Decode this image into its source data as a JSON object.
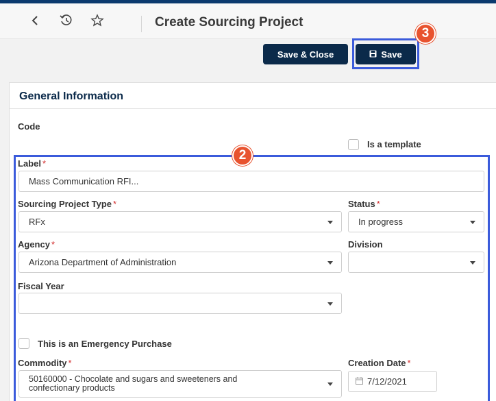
{
  "titlebar": {
    "title": "Create Sourcing Project",
    "icons": [
      "back-chevron-icon",
      "history-icon",
      "star-icon"
    ]
  },
  "toolbar": {
    "save_close_label": "Save & Close",
    "save_label": "Save"
  },
  "annotations": {
    "step_3": "3",
    "step_2": "2"
  },
  "section": {
    "title": "General Information"
  },
  "form": {
    "code_label": "Code",
    "template_label": "Is a template",
    "label_label": "Label",
    "label_value": "Mass Communication RFI...",
    "type_label": "Sourcing Project Type",
    "type_value": "RFx",
    "status_label": "Status",
    "status_value": "In progress",
    "agency_label": "Agency",
    "agency_value": "Arizona Department of Administration",
    "division_label": "Division",
    "division_value": "",
    "fiscal_label": "Fiscal Year",
    "fiscal_value": "",
    "emergency_label": "This is an Emergency Purchase",
    "commodity_label": "Commodity",
    "commodity_value": "50160000 - Chocolate and sugars and sweeteners and confectionary products",
    "creation_label": "Creation Date",
    "creation_value": "7/12/2021",
    "required_mark": "*"
  },
  "colors": {
    "accent": "#0b2a4a",
    "highlight": "#3b5bdb",
    "badge": "#e8532f",
    "required": "#d32f2f"
  }
}
